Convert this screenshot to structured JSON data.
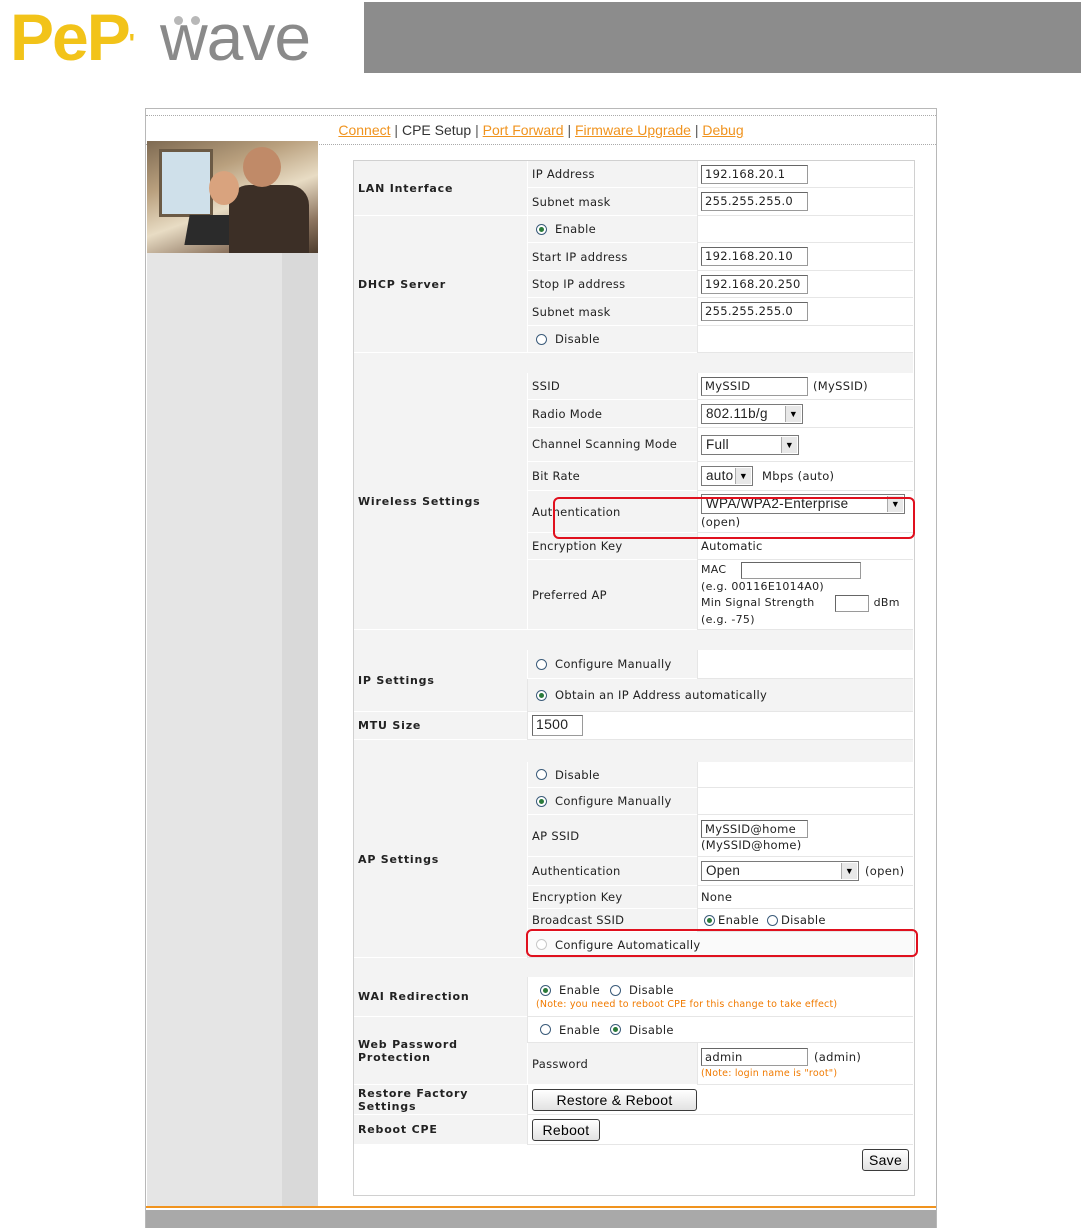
{
  "brand": {
    "logo_left": "PeP",
    "logo_right": "wave",
    "accent_color": "#f2c319",
    "link_color": "#f0931e",
    "highlight_color": "#e0101e"
  },
  "nav": [
    {
      "label": "Connect",
      "link": true
    },
    {
      "label": "CPE Setup",
      "link": false
    },
    {
      "label": "Port Forward",
      "link": true
    },
    {
      "label": "Firmware Upgrade",
      "link": true
    },
    {
      "label": "Debug",
      "link": true
    }
  ],
  "nav_separator": "|",
  "lan": {
    "section": "LAN Interface",
    "ip_label": "IP Address",
    "ip_value": "192.168.20.1",
    "mask_label": "Subnet mask",
    "mask_value": "255.255.255.0"
  },
  "dhcp": {
    "section": "DHCP Server",
    "enable_label": "Enable",
    "start_label": "Start IP address",
    "start_value": "192.168.20.10",
    "stop_label": "Stop IP address",
    "stop_value": "192.168.20.250",
    "mask_label": "Subnet mask",
    "mask_value": "255.255.255.0",
    "disable_label": "Disable",
    "selected": "Enable"
  },
  "wireless": {
    "section": "Wireless Settings",
    "ssid_label": "SSID",
    "ssid_value": "MySSID",
    "ssid_hint": "(MySSID)",
    "radio_label": "Radio Mode",
    "radio_value": "802.11b/g",
    "scan_label": "Channel Scanning Mode",
    "scan_value": "Full",
    "bitrate_label": "Bit Rate",
    "bitrate_value": "auto",
    "bitrate_hint": "Mbps (auto)",
    "auth_label": "Authentication",
    "auth_value": "WPA/WPA2-Enterprise",
    "auth_hint": "(open)",
    "enc_label": "Encryption Key",
    "enc_value": "Automatic",
    "pref_label": "Preferred AP",
    "mac_label": "MAC",
    "mac_value": "",
    "mac_hint": "(e.g. 00116E1014A0)",
    "signal_label": "Min Signal Strength",
    "signal_value": "",
    "signal_unit": "dBm",
    "signal_hint": "(e.g. -75)"
  },
  "ip": {
    "section": "IP Settings",
    "manual_label": "Configure Manually",
    "auto_label": "Obtain an IP Address automatically",
    "selected": "auto"
  },
  "mtu": {
    "section": "MTU Size",
    "value": "1500"
  },
  "ap": {
    "section": "AP Settings",
    "disable_label": "Disable",
    "manual_label": "Configure Manually",
    "ssid_label": "AP SSID",
    "ssid_value": "MySSID@home",
    "ssid_hint": "(MySSID@home)",
    "auth_label": "Authentication",
    "auth_value": "Open",
    "auth_hint": "(open)",
    "enc_label": "Encryption Key",
    "enc_value": "None",
    "broadcast_label": "Broadcast SSID",
    "broadcast_enable": "Enable",
    "broadcast_disable": "Disable",
    "auto_label": "Configure Automatically",
    "selected": "manual"
  },
  "wai": {
    "section": "WAI Redirection",
    "enable_label": "Enable",
    "disable_label": "Disable",
    "note": "(Note: you need to reboot CPE for this change to take effect)",
    "selected": "Enable"
  },
  "webpass": {
    "section": "Web Password Protection",
    "enable_label": "Enable",
    "disable_label": "Disable",
    "password_label": "Password",
    "password_value": "admin",
    "password_hint": "(admin)",
    "note": "(Note: login name is \"root\")",
    "selected": "Disable"
  },
  "restore": {
    "section": "Restore Factory Settings",
    "button": "Restore & Reboot"
  },
  "reboot": {
    "section": "Reboot CPE",
    "button": "Reboot"
  },
  "save_button": "Save"
}
